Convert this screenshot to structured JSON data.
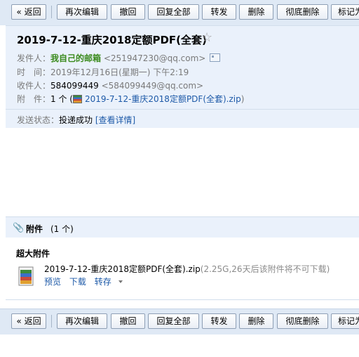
{
  "toolbar": {
    "back": "« 返回",
    "re_edit": "再次编辑",
    "recall": "撤回",
    "reply_all": "回复全部",
    "forward": "转发",
    "delete": "删除",
    "delete_permanently": "彻底删除",
    "mark_as": "标记为"
  },
  "mail": {
    "subject": "2019-7-12-重庆2018定额PDF(全套)",
    "star_icon": "☆",
    "sender_label": "发件人：",
    "sender_name": "我自己的邮箱",
    "sender_email": "<251947230@qq.com>",
    "time_label": "时　间：",
    "time_value": "2019年12月16日(星期一) 下午2:19",
    "recipient_label": "收件人：",
    "recipient_name": "584099449",
    "recipient_email": "<584099449@qq.com>",
    "attachment_label": "附　件：",
    "attachment_count": "1 个 (",
    "attachment_file": "2019-7-12-重庆2018定额PDF(全套).zip",
    "attachment_close": ")",
    "status_label": "发送状态：",
    "status_value": "投递成功",
    "status_detail": "[查看详情]"
  },
  "attachments": {
    "clip_icon": "📎",
    "title": "附件",
    "count": "(1 个)",
    "section_label": "超大附件",
    "file_name": "2019-7-12-重庆2018定额PDF(全套).zip",
    "file_info": "(2.25G,26天后该附件将不可下载)",
    "actions": {
      "preview": "预览",
      "download": "下载",
      "save_to": "转存"
    }
  }
}
